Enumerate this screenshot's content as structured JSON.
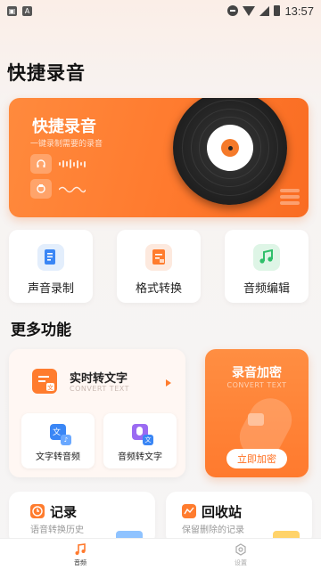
{
  "status_bar": {
    "time": "13:57",
    "left_icons": [
      "notification-icon",
      "image-icon"
    ],
    "right_icons": [
      "dnd-icon",
      "wifi-icon",
      "signal-icon",
      "battery-icon"
    ]
  },
  "page_title": "快捷录音",
  "hero": {
    "title": "快捷录音",
    "subtitle": "一键录制需要的录音",
    "icons": [
      "headphones-icon",
      "audio-wave-icon",
      "recorder-icon",
      "wave-line-icon",
      "vinyl-record-icon",
      "menu-lines-icon"
    ]
  },
  "tools": [
    {
      "label": "声音录制",
      "icon": "voice-record-icon"
    },
    {
      "label": "格式转换",
      "icon": "format-convert-icon"
    },
    {
      "label": "音频编辑",
      "icon": "audio-edit-icon"
    }
  ],
  "more_section": {
    "title": "更多功能",
    "realtime": {
      "title": "实时转文字",
      "subtitle": "CONVERT TEXT"
    },
    "text_to_audio": {
      "label": "文字转音频"
    },
    "audio_to_text": {
      "label": "音频转文字"
    },
    "encrypt": {
      "title": "录音加密",
      "subtitle": "CONVERT TEXT",
      "button": "立即加密"
    }
  },
  "records": {
    "title": "记录",
    "subtitle": "语音转换历史"
  },
  "recycle": {
    "title": "回收站",
    "subtitle": "保留删除的记录"
  },
  "bottom_nav": [
    {
      "label": "音频",
      "icon": "music-note-icon",
      "active": true
    },
    {
      "label": "设置",
      "icon": "settings-icon",
      "active": false
    }
  ],
  "colors": {
    "accent": "#ff7a2e",
    "background": "#f6f5f5",
    "nav_active": "#ff7a2e",
    "nav_inactive": "#aaaaaa"
  }
}
